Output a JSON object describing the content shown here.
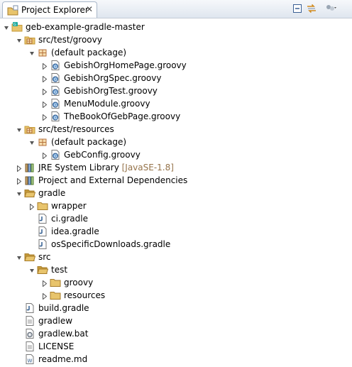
{
  "view": {
    "title": "Project Explorer",
    "close_glyph": "✕",
    "toolbar": [
      {
        "name": "collapse-all-button",
        "icon": "collapse-all-icon"
      },
      {
        "name": "link-with-editor-button",
        "icon": "link-with-editor-icon"
      },
      {
        "name": "view-menu-button",
        "icon": "view-menu-icon"
      }
    ]
  },
  "tree": [
    {
      "label": "geb-example-gradle-master",
      "depth": 0,
      "twisty": "expanded",
      "icon": "gradle-project-icon"
    },
    {
      "label": "src/test/groovy",
      "depth": 1,
      "twisty": "expanded",
      "icon": "source-folder-icon"
    },
    {
      "label": "(default package)",
      "depth": 2,
      "twisty": "expanded",
      "icon": "package-icon"
    },
    {
      "label": "GebishOrgHomePage.groovy",
      "depth": 3,
      "twisty": "collapsed",
      "icon": "groovy-file-icon"
    },
    {
      "label": "GebishOrgSpec.groovy",
      "depth": 3,
      "twisty": "collapsed",
      "icon": "groovy-file-icon"
    },
    {
      "label": "GebishOrgTest.groovy",
      "depth": 3,
      "twisty": "collapsed",
      "icon": "groovy-file-icon"
    },
    {
      "label": "MenuModule.groovy",
      "depth": 3,
      "twisty": "collapsed",
      "icon": "groovy-file-icon"
    },
    {
      "label": "TheBookOfGebPage.groovy",
      "depth": 3,
      "twisty": "collapsed",
      "icon": "groovy-file-icon"
    },
    {
      "label": "src/test/resources",
      "depth": 1,
      "twisty": "expanded",
      "icon": "source-folder-icon"
    },
    {
      "label": "(default package)",
      "depth": 2,
      "twisty": "expanded",
      "icon": "package-icon"
    },
    {
      "label": "GebConfig.groovy",
      "depth": 3,
      "twisty": "collapsed",
      "icon": "groovy-file-icon"
    },
    {
      "label": "JRE System Library",
      "decoration": "[JavaSE-1.8]",
      "depth": 1,
      "twisty": "collapsed",
      "icon": "library-icon"
    },
    {
      "label": "Project and External Dependencies",
      "depth": 1,
      "twisty": "collapsed",
      "icon": "library-icon"
    },
    {
      "label": "gradle",
      "depth": 1,
      "twisty": "expanded",
      "icon": "folder-open-icon"
    },
    {
      "label": "wrapper",
      "depth": 2,
      "twisty": "collapsed",
      "icon": "folder-icon"
    },
    {
      "label": "ci.gradle",
      "depth": 2,
      "twisty": "none",
      "icon": "gradle-file-icon"
    },
    {
      "label": "idea.gradle",
      "depth": 2,
      "twisty": "none",
      "icon": "gradle-file-icon"
    },
    {
      "label": "osSpecificDownloads.gradle",
      "depth": 2,
      "twisty": "none",
      "icon": "gradle-file-icon"
    },
    {
      "label": "src",
      "depth": 1,
      "twisty": "expanded",
      "icon": "folder-open-icon"
    },
    {
      "label": "test",
      "depth": 2,
      "twisty": "expanded",
      "icon": "folder-open-icon"
    },
    {
      "label": "groovy",
      "depth": 3,
      "twisty": "collapsed",
      "icon": "folder-icon"
    },
    {
      "label": "resources",
      "depth": 3,
      "twisty": "collapsed",
      "icon": "folder-icon"
    },
    {
      "label": "build.gradle",
      "depth": 1,
      "twisty": "none",
      "icon": "gradle-file-icon"
    },
    {
      "label": "gradlew",
      "depth": 1,
      "twisty": "none",
      "icon": "text-file-icon"
    },
    {
      "label": "gradlew.bat",
      "depth": 1,
      "twisty": "none",
      "icon": "batch-file-icon"
    },
    {
      "label": "LICENSE",
      "depth": 1,
      "twisty": "none",
      "icon": "text-file-icon"
    },
    {
      "label": "readme.md",
      "depth": 1,
      "twisty": "none",
      "icon": "markdown-file-icon"
    }
  ],
  "colors": {
    "decoration": "#95734a",
    "folder": "#e8c46c",
    "folder_dark": "#c49a3a",
    "package": "#b5713c",
    "twisty": "#555555"
  }
}
